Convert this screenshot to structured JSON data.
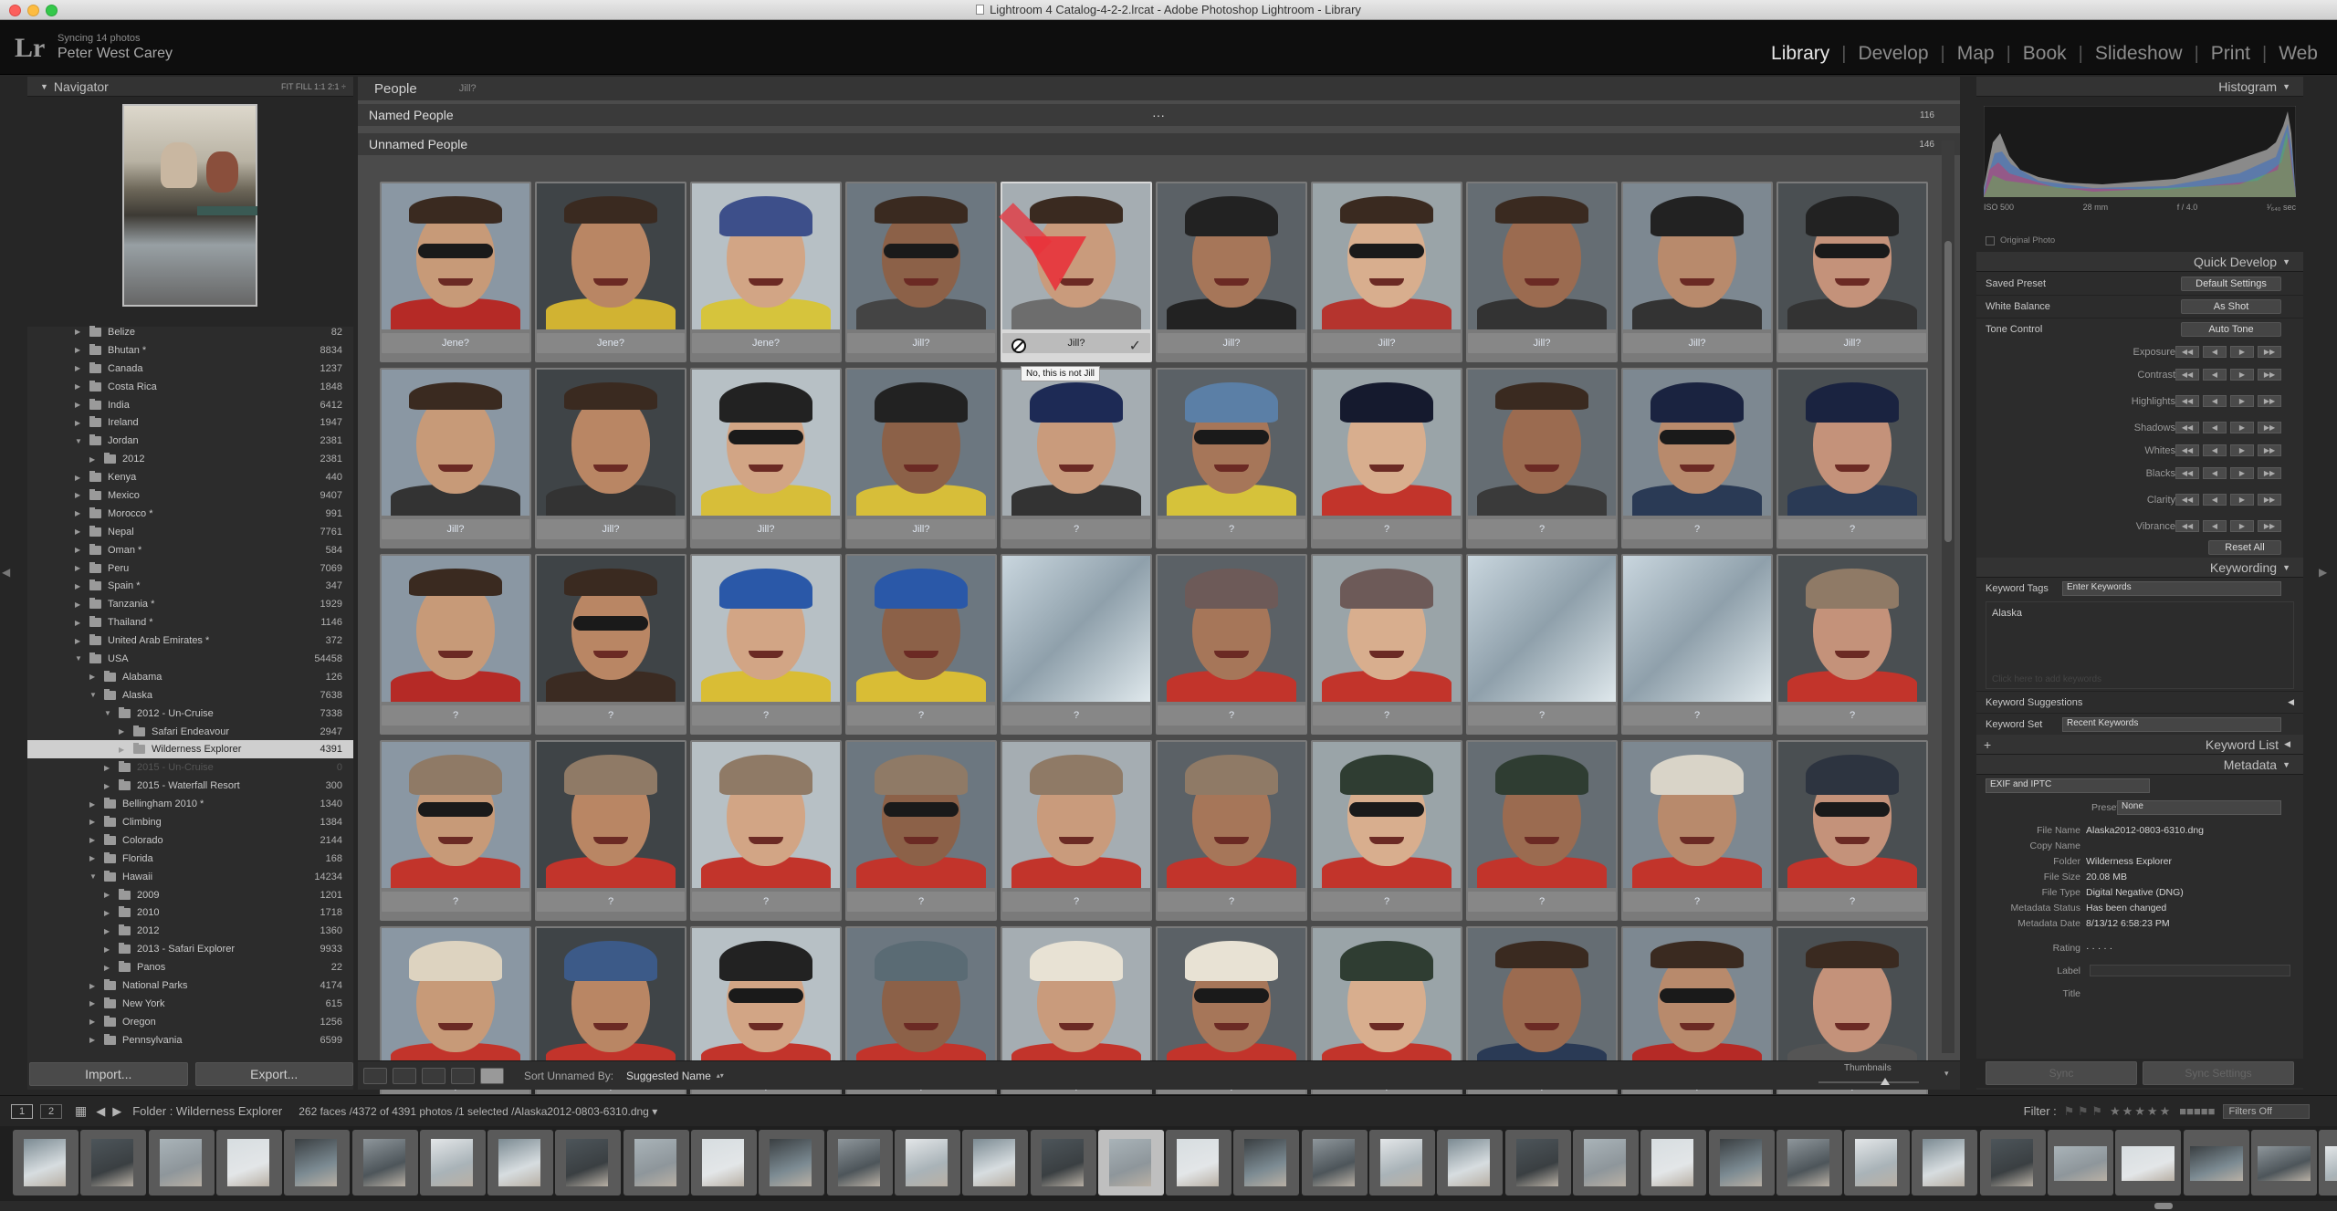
{
  "window": {
    "title": "Lightroom 4 Catalog-4-2-2.lrcat - Adobe Photoshop Lightroom - Library"
  },
  "identity": {
    "logo": "Lr",
    "sync_status": "Syncing 14 photos",
    "user": "Peter West Carey"
  },
  "modules": [
    "Library",
    "Develop",
    "Map",
    "Book",
    "Slideshow",
    "Print",
    "Web"
  ],
  "active_module": "Library",
  "navigator": {
    "title": "Navigator",
    "zoom_options": "FIT  FILL  1:1  2:1 ÷"
  },
  "folders": [
    {
      "name": "Belize",
      "count": "82",
      "level": 1,
      "expanded": false
    },
    {
      "name": "Bhutan *",
      "count": "8834",
      "level": 1,
      "expanded": false
    },
    {
      "name": "Canada",
      "count": "1237",
      "level": 1,
      "expanded": false
    },
    {
      "name": "Costa Rica",
      "count": "1848",
      "level": 1,
      "expanded": false
    },
    {
      "name": "India",
      "count": "6412",
      "level": 1,
      "expanded": false
    },
    {
      "name": "Ireland",
      "count": "1947",
      "level": 1,
      "expanded": false
    },
    {
      "name": "Jordan",
      "count": "2381",
      "level": 1,
      "expanded": true
    },
    {
      "name": "2012",
      "count": "2381",
      "level": 2,
      "expanded": false
    },
    {
      "name": "Kenya",
      "count": "440",
      "level": 1,
      "expanded": false
    },
    {
      "name": "Mexico",
      "count": "9407",
      "level": 1,
      "expanded": false
    },
    {
      "name": "Morocco *",
      "count": "991",
      "level": 1,
      "expanded": false
    },
    {
      "name": "Nepal",
      "count": "7761",
      "level": 1,
      "expanded": false
    },
    {
      "name": "Oman *",
      "count": "584",
      "level": 1,
      "expanded": false
    },
    {
      "name": "Peru",
      "count": "7069",
      "level": 1,
      "expanded": false
    },
    {
      "name": "Spain *",
      "count": "347",
      "level": 1,
      "expanded": false
    },
    {
      "name": "Tanzania *",
      "count": "1929",
      "level": 1,
      "expanded": false
    },
    {
      "name": "Thailand *",
      "count": "1146",
      "level": 1,
      "expanded": false
    },
    {
      "name": "United Arab Emirates *",
      "count": "372",
      "level": 1,
      "expanded": false
    },
    {
      "name": "USA",
      "count": "54458",
      "level": 1,
      "expanded": true
    },
    {
      "name": "Alabama",
      "count": "126",
      "level": 2,
      "expanded": false
    },
    {
      "name": "Alaska",
      "count": "7638",
      "level": 2,
      "expanded": true
    },
    {
      "name": "2012 - Un-Cruise",
      "count": "7338",
      "level": 3,
      "expanded": true
    },
    {
      "name": "Safari Endeavour",
      "count": "2947",
      "level": 4,
      "expanded": false
    },
    {
      "name": "Wilderness Explorer",
      "count": "4391",
      "level": 4,
      "expanded": false,
      "selected": true
    },
    {
      "name": "2015 - Un-Cruise",
      "count": "0",
      "level": 3,
      "expanded": false,
      "dim": true
    },
    {
      "name": "2015 - Waterfall Resort",
      "count": "300",
      "level": 3,
      "expanded": false
    },
    {
      "name": "Bellingham 2010 *",
      "count": "1340",
      "level": 2,
      "expanded": false
    },
    {
      "name": "Climbing",
      "count": "1384",
      "level": 2,
      "expanded": false
    },
    {
      "name": "Colorado",
      "count": "2144",
      "level": 2,
      "expanded": false
    },
    {
      "name": "Florida",
      "count": "168",
      "level": 2,
      "expanded": false
    },
    {
      "name": "Hawaii",
      "count": "14234",
      "level": 2,
      "expanded": true
    },
    {
      "name": "2009",
      "count": "1201",
      "level": 3,
      "expanded": false
    },
    {
      "name": "2010",
      "count": "1718",
      "level": 3,
      "expanded": false
    },
    {
      "name": "2012",
      "count": "1360",
      "level": 3,
      "expanded": false
    },
    {
      "name": "2013 - Safari Explorer",
      "count": "9933",
      "level": 3,
      "expanded": false
    },
    {
      "name": "Panos",
      "count": "22",
      "level": 3,
      "expanded": false
    },
    {
      "name": "National Parks",
      "count": "4174",
      "level": 2,
      "expanded": false
    },
    {
      "name": "New York",
      "count": "615",
      "level": 2,
      "expanded": false
    },
    {
      "name": "Oregon",
      "count": "1256",
      "level": 2,
      "expanded": false
    },
    {
      "name": "Pennsylvania",
      "count": "6599",
      "level": 2,
      "expanded": false
    }
  ],
  "left_buttons": {
    "import": "Import...",
    "export": "Export..."
  },
  "people": {
    "header": "People",
    "filter": "Jill?",
    "named_label": "Named People",
    "named_count": "116",
    "named_dots": "···",
    "unnamed_label": "Unnamed People",
    "unnamed_count": "146"
  },
  "faces": [
    "Jene?",
    "Jene?",
    "Jene?",
    "Jill?",
    "Jill?",
    "Jill?",
    "Jill?",
    "Jill?",
    "Jill?",
    "Jill?",
    "Jill?",
    "Jill?",
    "Jill?",
    "Jill?",
    "?",
    "?",
    "?",
    "?",
    "?",
    "?",
    "?",
    "?",
    "?",
    "?",
    "?",
    "?",
    "?",
    "?",
    "?",
    "?",
    "?",
    "?",
    "?",
    "?",
    "?",
    "?",
    "?",
    "?",
    "?",
    "?",
    "?",
    "?",
    "?",
    "?",
    "?",
    "?",
    "?",
    "?",
    "?",
    "?"
  ],
  "tooltip": "No, this is not Jill",
  "toolbar": {
    "sort_label": "Sort Unnamed By:",
    "sort_value": "Suggested Name",
    "thumbnails": "Thumbnails"
  },
  "right_panel": {
    "histogram": "Histogram",
    "iso": "ISO 500",
    "focal": "28 mm",
    "aperture": "f / 4.0",
    "shutter": "¹⁄₆₄₀ sec",
    "original_photo": "Original Photo",
    "quick_develop": "Quick Develop",
    "saved_preset_label": "Saved Preset",
    "saved_preset_value": "Default Settings",
    "white_balance_label": "White Balance",
    "white_balance_value": "As Shot",
    "tone_control_label": "Tone Control",
    "auto_tone": "Auto Tone",
    "tone_rows": [
      "Exposure",
      "Contrast",
      "Highlights",
      "Shadows",
      "Whites",
      "Blacks",
      "Clarity",
      "Vibrance"
    ],
    "reset_all": "Reset All",
    "keywording": "Keywording",
    "keyword_tags_label": "Keyword Tags",
    "keyword_tags_value": "Enter Keywords",
    "keywords": "Alaska",
    "keyword_placeholder": "Click here to add keywords",
    "keyword_suggestions": "Keyword Suggestions",
    "keyword_set_label": "Keyword Set",
    "keyword_set_value": "Recent Keywords",
    "keyword_list": "Keyword List",
    "metadata": "Metadata",
    "metadata_view": "EXIF and IPTC",
    "preset_label": "Preset",
    "preset_value": "None",
    "meta": [
      {
        "k": "File Name",
        "v": "Alaska2012-0803-6310.dng"
      },
      {
        "k": "Copy Name",
        "v": ""
      },
      {
        "k": "Folder",
        "v": "Wilderness Explorer"
      },
      {
        "k": "File Size",
        "v": "20.08 MB"
      },
      {
        "k": "File Type",
        "v": "Digital Negative (DNG)"
      },
      {
        "k": "Metadata Status",
        "v": "Has been changed"
      },
      {
        "k": "Metadata Date",
        "v": "8/13/12 6:58:23 PM"
      },
      {
        "k": "Rating",
        "v": "· · · · ·"
      },
      {
        "k": "Label",
        "v": ""
      },
      {
        "k": "Title",
        "v": ""
      }
    ],
    "sync": "Sync",
    "sync_settings": "Sync Settings"
  },
  "filmstrip_bar": {
    "page1": "1",
    "page2": "2",
    "source": "Folder : Wilderness Explorer",
    "info": "262 faces /4372 of 4391 photos /1 selected /Alaska2012-0803-6310.dng ▾",
    "filter_label": "Filter :",
    "filter_value": "Filters Off"
  },
  "colors": {
    "accent": "#e6e6e6",
    "panel": "#2c2c2c",
    "grid_bg": "#4b4b4b",
    "cell": "#7a7a7a",
    "tooltip_arrow": "#e8333b"
  }
}
